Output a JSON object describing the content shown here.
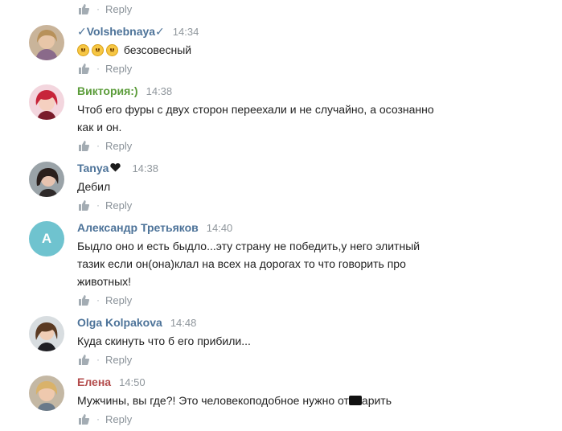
{
  "reply_label": "Reply",
  "comments": [
    {
      "author": "✓Volshebnaya✓",
      "time": "14:34",
      "text": "безсовесный",
      "emoji_count": 3
    },
    {
      "author": "Виктория:)",
      "time": "14:38",
      "text_lines": [
        "Чтоб его фуры с двух сторон переехали и не случайно, а осознанно",
        "как и он."
      ]
    },
    {
      "author": "Tanya",
      "time": "14:38",
      "text": "Дебил"
    },
    {
      "author": "Александр Третьяков",
      "time": "14:40",
      "avatar_letter": "А",
      "text_lines": [
        "Быдло оно и есть быдло...эту страну не победить,у него элитный",
        "тазик если он(она)клал на всех на дорогах то что говорить про",
        "животных!"
      ]
    },
    {
      "author": "Olga Kolpakova",
      "time": "14:48",
      "text": "Куда скинуть что б его прибили..."
    },
    {
      "author": "Елена",
      "time": "14:50",
      "text_before": "Мужчины, вы где?! Это человекоподобное нужно от",
      "text_after": "арить"
    }
  ],
  "colors": {
    "author": "#4d7399",
    "author_green": "#5b9c3a",
    "author_red": "#b34b4b",
    "meta": "#8a9299",
    "avatar_letter_bg": "#6fc3cf"
  }
}
